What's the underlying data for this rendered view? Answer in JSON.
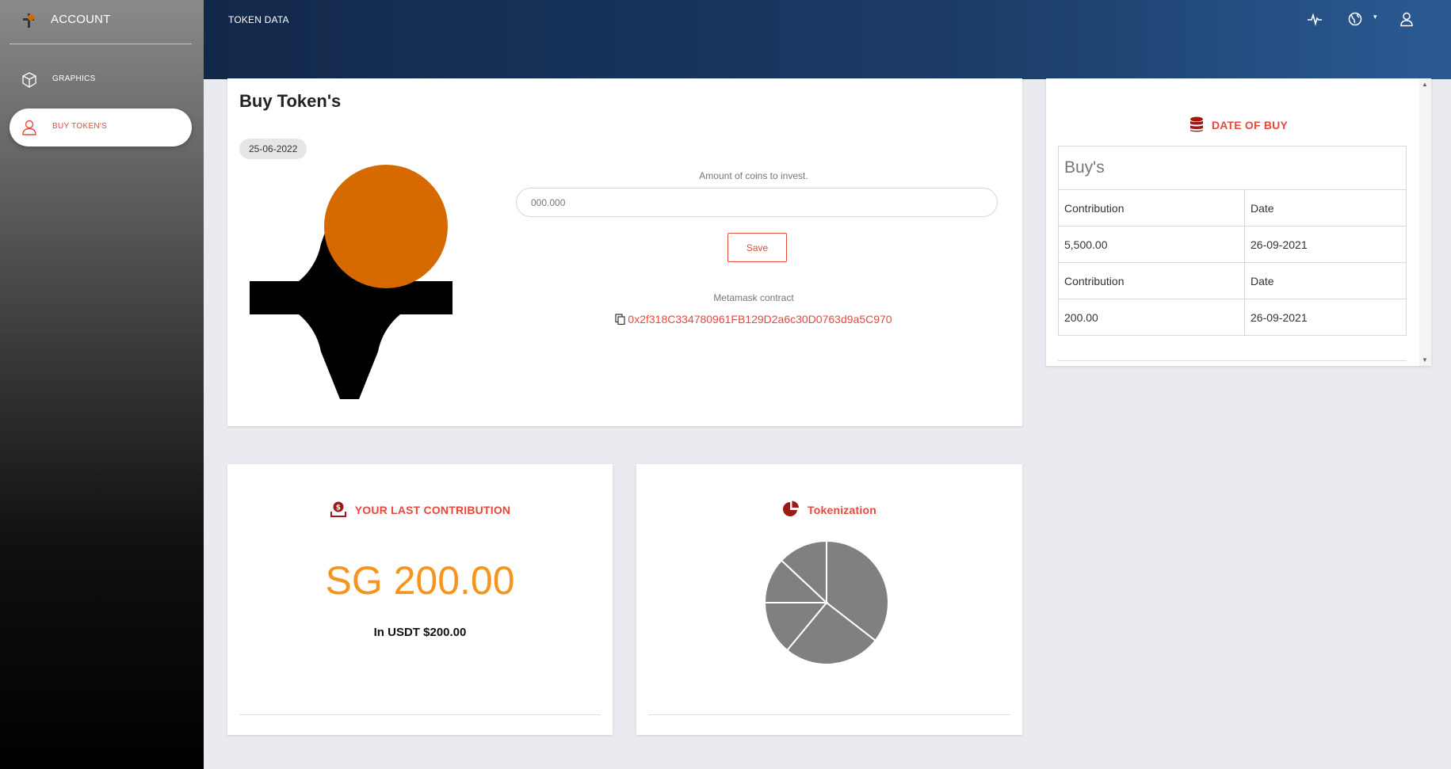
{
  "app": {
    "title": "ACCOUNT",
    "logo_icon": "token-logo-icon"
  },
  "sidebar": {
    "items": [
      {
        "label": "GRAPHICS",
        "icon": "cube-icon",
        "active": false
      },
      {
        "label": "BUY TOKEN'S",
        "icon": "user-icon",
        "active": true
      }
    ]
  },
  "header": {
    "title": "TOKEN DATA",
    "icons": [
      "activity-icon",
      "globe-icon",
      "user-icon"
    ]
  },
  "buy": {
    "title": "Buy Token's",
    "date": "25-06-2022",
    "amount_label": "Amount of coins to invest.",
    "amount_placeholder": "000.000",
    "save_label": "Save",
    "metamask_label": "Metamask contract",
    "contract_address": "0x2f318C334780961FB129D2a6c30D0763d9a5C970"
  },
  "date_of_buy": {
    "title": "DATE OF BUY",
    "table_caption": "Buy's",
    "rows": [
      [
        "Contribution",
        "Date"
      ],
      [
        "5,500.00",
        "26-09-2021"
      ],
      [
        "Contribution",
        "Date"
      ],
      [
        "200.00",
        "26-09-2021"
      ]
    ]
  },
  "last_contribution": {
    "title": "YOUR LAST CONTRIBUTION",
    "amount": "SG 200.00",
    "usdt": "In USDT $200.00"
  },
  "tokenization": {
    "title": "Tokenization"
  },
  "chart_data": {
    "type": "pie",
    "slices": [
      0.355,
      0.255,
      0.14,
      0.12,
      0.13
    ],
    "colors": [
      "#808080",
      "#808080",
      "#808080",
      "#808080",
      "#808080"
    ]
  },
  "colors": {
    "accent": "#e8483c",
    "amount": "#f7941d",
    "dark_red": "#9b1b14",
    "logo_orange": "#d66a00"
  }
}
